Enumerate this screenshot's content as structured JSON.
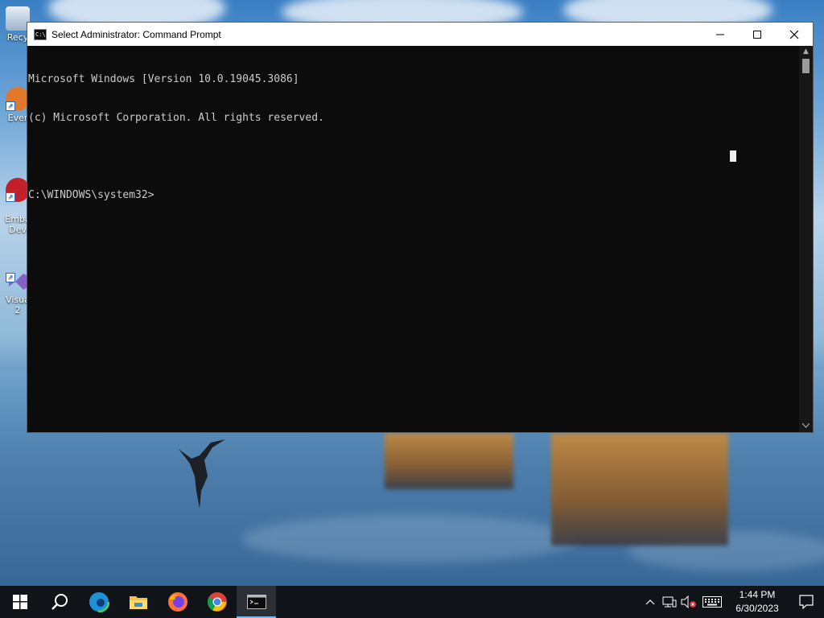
{
  "desktop": {
    "icons": [
      {
        "label": "Recy"
      },
      {
        "label": "Ever"
      },
      {
        "label": "Emba\nDev"
      },
      {
        "label": "Visua\n2"
      }
    ]
  },
  "window": {
    "title": "Select Administrator:  Command Prompt",
    "console_lines": [
      "Microsoft Windows [Version 10.0.19045.3086]",
      "(c) Microsoft Corporation. All rights reserved.",
      "",
      "C:\\WINDOWS\\system32>"
    ],
    "controls": {
      "minimize": "─",
      "maximize": "☐",
      "close": "✕"
    }
  },
  "taskbar": {
    "apps": [
      {
        "name": "start",
        "icon": "windows-logo-icon"
      },
      {
        "name": "search",
        "icon": "search-icon"
      },
      {
        "name": "edge",
        "icon": "edge-icon"
      },
      {
        "name": "file-explorer",
        "icon": "folder-icon"
      },
      {
        "name": "firefox",
        "icon": "firefox-icon"
      },
      {
        "name": "chrome",
        "icon": "chrome-icon"
      },
      {
        "name": "command-prompt",
        "icon": "cmd-icon",
        "active": true
      }
    ],
    "tray": {
      "chevron": "^",
      "time": "1:44 PM",
      "date": "6/30/2023"
    }
  },
  "colors": {
    "console_bg": "#0c0c0c",
    "console_text": "#cccccc",
    "taskbar_bg": "#101318",
    "active_accent": "#76b9ed"
  }
}
